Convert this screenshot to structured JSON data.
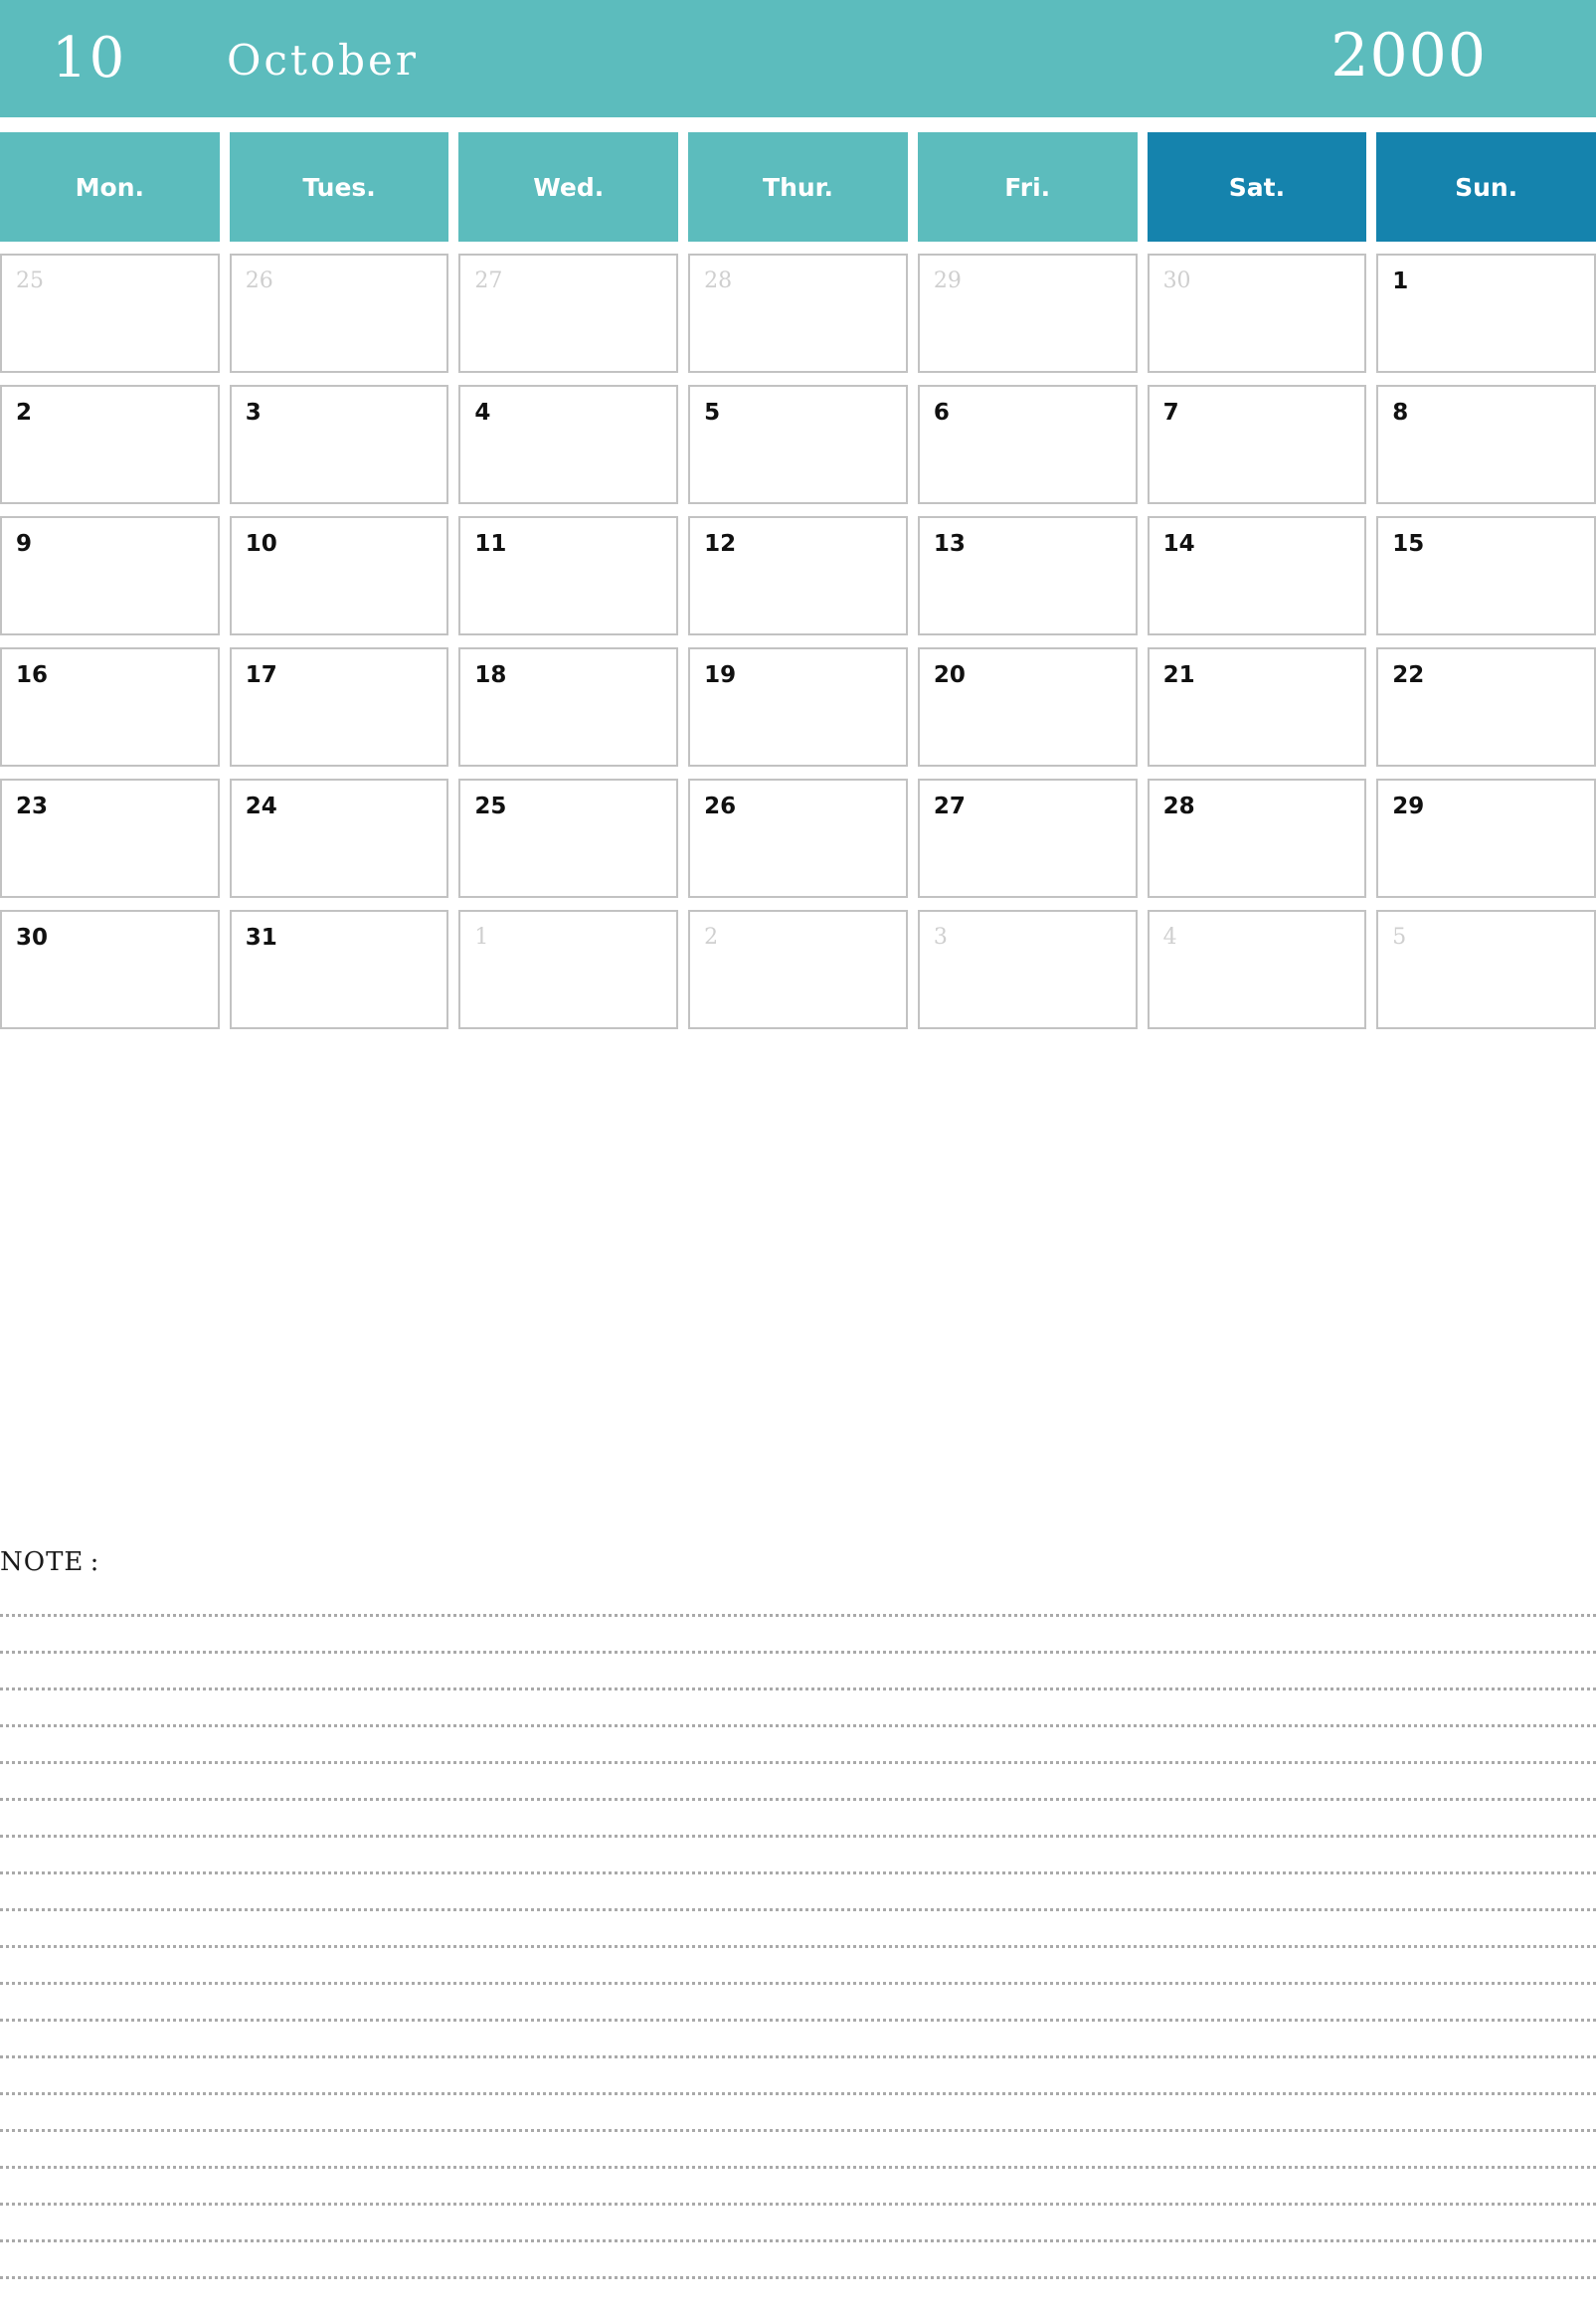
{
  "header": {
    "month_number": "10",
    "month_name": "October",
    "year": "2000",
    "background_color": "#5CBCBD",
    "text_color": "#ffffff"
  },
  "colors": {
    "weekday_teal": "#5CBCBD",
    "weekend_blue": "#1583AD",
    "cell_border": "#c2c2c2",
    "in_month_text": "#111111",
    "out_month_text": "#cfcfcf",
    "note_rule": "#a9a9a9"
  },
  "weekdays": [
    {
      "label": "Mon.",
      "weekend": false
    },
    {
      "label": "Tues.",
      "weekend": false
    },
    {
      "label": "Wed.",
      "weekend": false
    },
    {
      "label": "Thur.",
      "weekend": false
    },
    {
      "label": "Fri.",
      "weekend": false
    },
    {
      "label": "Sat.",
      "weekend": true
    },
    {
      "label": "Sun.",
      "weekend": true
    }
  ],
  "weeks": [
    [
      {
        "day": "25",
        "in_month": false
      },
      {
        "day": "26",
        "in_month": false
      },
      {
        "day": "27",
        "in_month": false
      },
      {
        "day": "28",
        "in_month": false
      },
      {
        "day": "29",
        "in_month": false
      },
      {
        "day": "30",
        "in_month": false
      },
      {
        "day": "1",
        "in_month": true
      }
    ],
    [
      {
        "day": "2",
        "in_month": true
      },
      {
        "day": "3",
        "in_month": true
      },
      {
        "day": "4",
        "in_month": true
      },
      {
        "day": "5",
        "in_month": true
      },
      {
        "day": "6",
        "in_month": true
      },
      {
        "day": "7",
        "in_month": true
      },
      {
        "day": "8",
        "in_month": true
      }
    ],
    [
      {
        "day": "9",
        "in_month": true
      },
      {
        "day": "10",
        "in_month": true
      },
      {
        "day": "11",
        "in_month": true
      },
      {
        "day": "12",
        "in_month": true
      },
      {
        "day": "13",
        "in_month": true
      },
      {
        "day": "14",
        "in_month": true
      },
      {
        "day": "15",
        "in_month": true
      }
    ],
    [
      {
        "day": "16",
        "in_month": true
      },
      {
        "day": "17",
        "in_month": true
      },
      {
        "day": "18",
        "in_month": true
      },
      {
        "day": "19",
        "in_month": true
      },
      {
        "day": "20",
        "in_month": true
      },
      {
        "day": "21",
        "in_month": true
      },
      {
        "day": "22",
        "in_month": true
      }
    ],
    [
      {
        "day": "23",
        "in_month": true
      },
      {
        "day": "24",
        "in_month": true
      },
      {
        "day": "25",
        "in_month": true
      },
      {
        "day": "26",
        "in_month": true
      },
      {
        "day": "27",
        "in_month": true
      },
      {
        "day": "28",
        "in_month": true
      },
      {
        "day": "29",
        "in_month": true
      }
    ],
    [
      {
        "day": "30",
        "in_month": true
      },
      {
        "day": "31",
        "in_month": true
      },
      {
        "day": "1",
        "in_month": false
      },
      {
        "day": "2",
        "in_month": false
      },
      {
        "day": "3",
        "in_month": false
      },
      {
        "day": "4",
        "in_month": false
      },
      {
        "day": "5",
        "in_month": false
      }
    ]
  ],
  "note": {
    "label": "NOTE :",
    "line_count": 20
  }
}
